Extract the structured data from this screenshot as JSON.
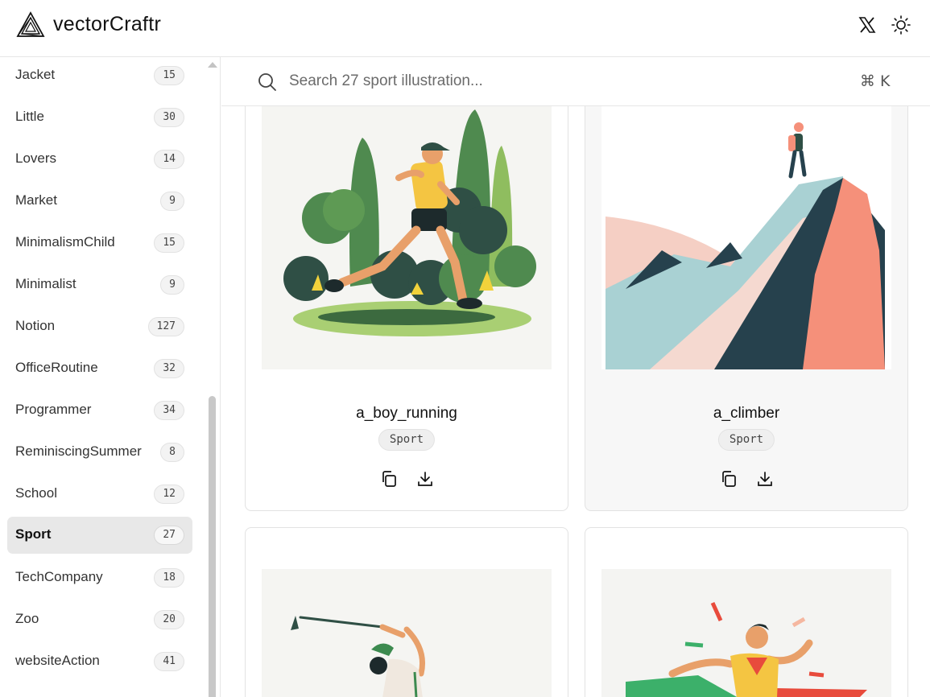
{
  "app": {
    "title": "vectorCraftr"
  },
  "header": {
    "x_icon": "x-logo-icon",
    "theme_icon": "sun-icon"
  },
  "sidebar": {
    "items": [
      {
        "label": "Jacket",
        "count": "15"
      },
      {
        "label": "Little",
        "count": "30"
      },
      {
        "label": "Lovers",
        "count": "14"
      },
      {
        "label": "Market",
        "count": "9"
      },
      {
        "label": "MinimalismChild",
        "count": "15"
      },
      {
        "label": "Minimalist",
        "count": "9"
      },
      {
        "label": "Notion",
        "count": "127"
      },
      {
        "label": "OfficeRoutine",
        "count": "32"
      },
      {
        "label": "Programmer",
        "count": "34"
      },
      {
        "label": "ReminiscingSummer",
        "count": "8"
      },
      {
        "label": "School",
        "count": "12"
      },
      {
        "label": "Sport",
        "count": "27",
        "active": true
      },
      {
        "label": "TechCompany",
        "count": "18"
      },
      {
        "label": "Zoo",
        "count": "20"
      },
      {
        "label": "websiteAction",
        "count": "41"
      }
    ]
  },
  "search": {
    "placeholder": "Search 27 sport illustration...",
    "value": "",
    "shortcut": "⌘ K"
  },
  "cards": [
    {
      "title": "a_boy_running",
      "tag": "Sport"
    },
    {
      "title": "a_climber",
      "tag": "Sport"
    },
    {
      "title": "",
      "tag": ""
    },
    {
      "title": "",
      "tag": ""
    }
  ],
  "colors": {
    "active_bg": "#e8e8e8",
    "border": "#e2e2e2",
    "tag_bg": "#efefef"
  }
}
